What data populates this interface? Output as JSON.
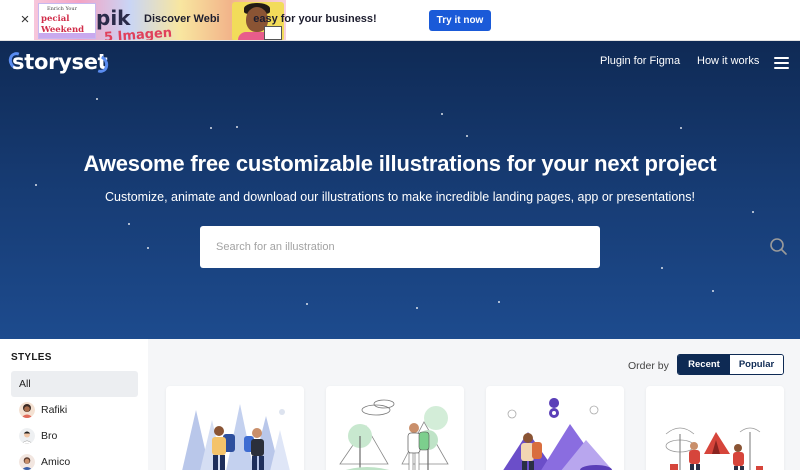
{
  "ad": {
    "close_label": "×",
    "art_small": "Enrich Your",
    "art_line1": "pecial",
    "art_line2": "Weekend",
    "art_brand": "pik",
    "art_red": "5 Imagen",
    "text": "Discover Webi           easy for your business!",
    "cta": "Try it now"
  },
  "nav": {
    "logo": "storyset",
    "links": [
      "Plugin for Figma",
      "How it works"
    ]
  },
  "hero": {
    "title": "Awesome free customizable illustrations for your next project",
    "subtitle": "Customize, animate and download our illustrations to make incredible landing pages, app or presentations!",
    "search_placeholder": "Search for an illustration"
  },
  "sidebar": {
    "heading": "STYLES",
    "items": [
      {
        "label": "All",
        "active": true
      },
      {
        "label": "Rafiki"
      },
      {
        "label": "Bro"
      },
      {
        "label": "Amico"
      }
    ]
  },
  "main": {
    "order_label": "Order by",
    "order_options": [
      "Recent",
      "Popular"
    ],
    "order_selected": "Recent"
  },
  "colors": {
    "hero_top": "#0f2a55",
    "hero_bottom": "#1d4b8e",
    "accent_button": "#1a5ad8",
    "toggle_dark": "#0e2a54"
  }
}
